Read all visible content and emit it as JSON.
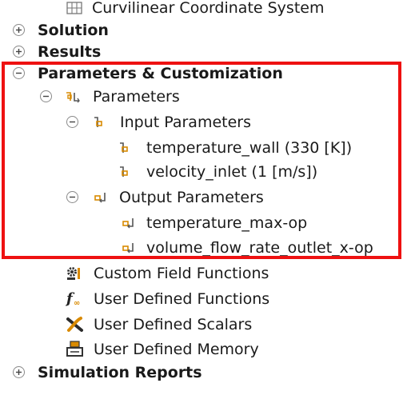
{
  "tree": {
    "curvilinear_label": "Curvilinear Coordinate System",
    "solution_label": "Solution",
    "results_label": "Results",
    "params_custom_label": "Parameters & Customization",
    "parameters_label": "Parameters",
    "input_params_label": "Input Parameters",
    "input_items": [
      "temperature_wall (330 [K])",
      "velocity_inlet (1 [m/s])"
    ],
    "output_params_label": "Output Parameters",
    "output_items": [
      "temperature_max-op",
      "volume_flow_rate_outlet_x-op"
    ],
    "custom_field_functions_label": "Custom Field Functions",
    "udf_label": "User Defined Functions",
    "uds_label": "User Defined Scalars",
    "udm_label": "User Defined Memory",
    "simulation_reports_label": "Simulation Reports"
  },
  "colors": {
    "highlight": "#ee1111",
    "param_icon": "#d98a00",
    "icon_gray": "#555555",
    "text": "#1a1a1a"
  },
  "icons": {
    "expand": "plus-circle-icon",
    "collapse": "minus-circle-icon",
    "coordinate": "grid-icon",
    "parameters": "parameters-icon",
    "input": "input-parameter-icon",
    "output": "output-parameter-icon",
    "custom_field": "gear-icon",
    "udf": "function-icon",
    "uds": "scalar-icon",
    "udm": "memory-icon"
  }
}
